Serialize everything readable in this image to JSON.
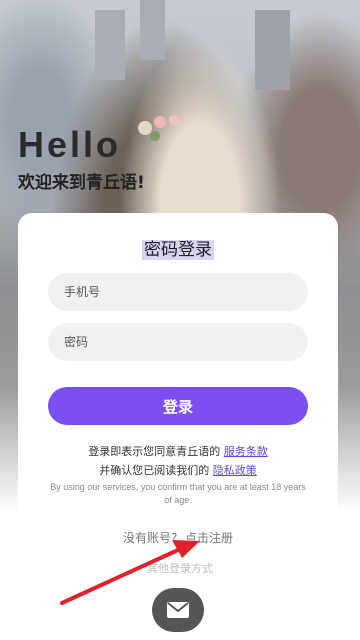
{
  "header": {
    "hello": "Hello",
    "welcome": "欢迎来到青丘语!"
  },
  "login_card": {
    "title": "密码登录",
    "phone_placeholder": "手机号",
    "password_placeholder": "密码",
    "login_label": "登录",
    "agree_line1_prefix": "登录即表示您同意青丘语的",
    "terms_link": "服务条款",
    "agree_line2_prefix": "并确认您已阅读我们的",
    "privacy_link": "隐私政策",
    "english_notice": "By using our services, you confirm that you are at least 18 years of age.",
    "no_account": "没有账号?",
    "register_link": "点击注册"
  },
  "footer": {
    "other_methods": "其他登录方式",
    "mail_icon": "mail-icon"
  },
  "colors": {
    "accent": "#7b4ff0",
    "link": "#5b4ad8",
    "annotation_arrow": "#e0202a"
  }
}
